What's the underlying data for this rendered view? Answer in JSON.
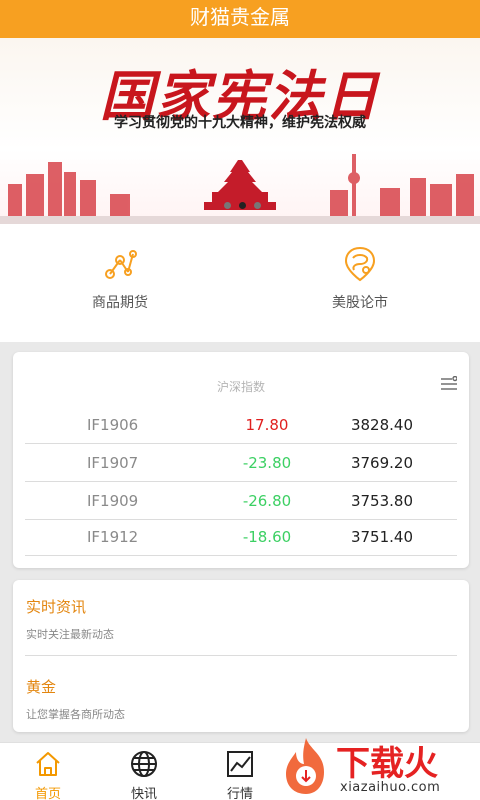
{
  "app": {
    "title": "财猫贵金属"
  },
  "banner": {
    "title": "国家宪法日",
    "subtitle": "学习贯彻党的十九大精神，维护宪法权威",
    "active_dot": 1
  },
  "quick_nav": [
    {
      "label": "商品期货",
      "icon": "node-graph-icon"
    },
    {
      "label": "美股论市",
      "icon": "location-pin-icon"
    }
  ],
  "index_card": {
    "title": "沪深指数",
    "rows": [
      {
        "code": "IF1906",
        "change": "17.80",
        "price": "3828.40",
        "trend": "up"
      },
      {
        "code": "IF1907",
        "change": "-23.80",
        "price": "3769.20",
        "trend": "down"
      },
      {
        "code": "IF1909",
        "change": "-26.80",
        "price": "3753.80",
        "trend": "down"
      },
      {
        "code": "IF1912",
        "change": "-18.60",
        "price": "3751.40",
        "trend": "down"
      }
    ],
    "colors": {
      "up": "#e0201f",
      "down": "#3cd063"
    }
  },
  "news": [
    {
      "title": "实时资讯",
      "subtitle": "实时关注最新动态"
    },
    {
      "title": "黄金",
      "subtitle": "让您掌握各商所动态"
    }
  ],
  "tabbar": [
    {
      "label": "首页",
      "icon": "home-icon",
      "active": true
    },
    {
      "label": "快讯",
      "icon": "globe-icon",
      "active": false
    },
    {
      "label": "行情",
      "icon": "chart-icon",
      "active": false
    }
  ],
  "watermark": {
    "text": "下载火",
    "url": "xiazaihuo.com"
  },
  "theme": {
    "accent": "#f7a021",
    "tab_active": "#f39800"
  }
}
